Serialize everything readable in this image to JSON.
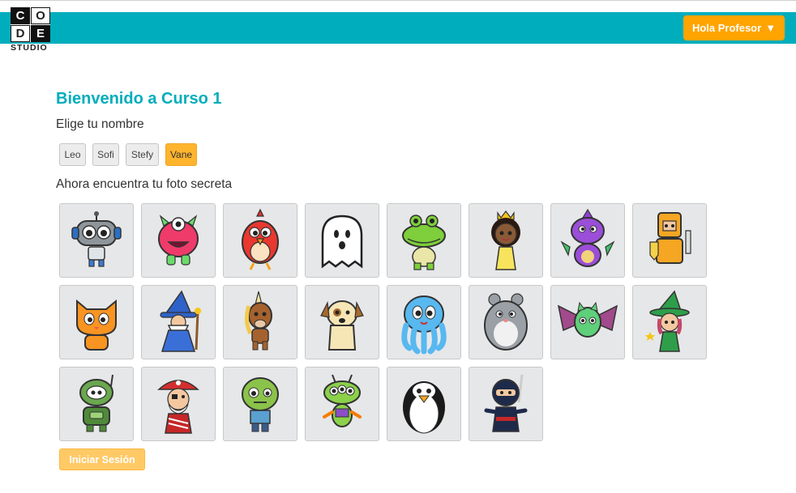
{
  "logo": {
    "letters": [
      "C",
      "O",
      "D",
      "E"
    ],
    "studio": "STUDIO"
  },
  "header": {
    "user_button": "Hola Profesor",
    "user_arrow": "▼"
  },
  "main": {
    "title": "Bienvenido a Curso 1",
    "choose_name": "Elige tu nombre",
    "names": [
      {
        "label": "Leo",
        "selected": false
      },
      {
        "label": "Sofi",
        "selected": false
      },
      {
        "label": "Stefy",
        "selected": false
      },
      {
        "label": "Vane",
        "selected": true
      }
    ],
    "find_photo": "Ahora encuentra tu foto secreta",
    "login_button": "Iniciar Sesión"
  },
  "pictures": [
    "robot",
    "pink-monster",
    "red-bird",
    "ghost",
    "green-crocodile",
    "princess",
    "purple-dragon",
    "knight",
    "orange-cat",
    "wizard",
    "unicorn",
    "dog",
    "octopus",
    "hamster",
    "bat",
    "witch",
    "green-robot",
    "pirate",
    "zombie",
    "alien",
    "penguin",
    "ninja"
  ],
  "colors": {
    "header": "#00adbc",
    "accent": "#ffa400",
    "title": "#00adbc",
    "selected": "#ffb42e"
  }
}
